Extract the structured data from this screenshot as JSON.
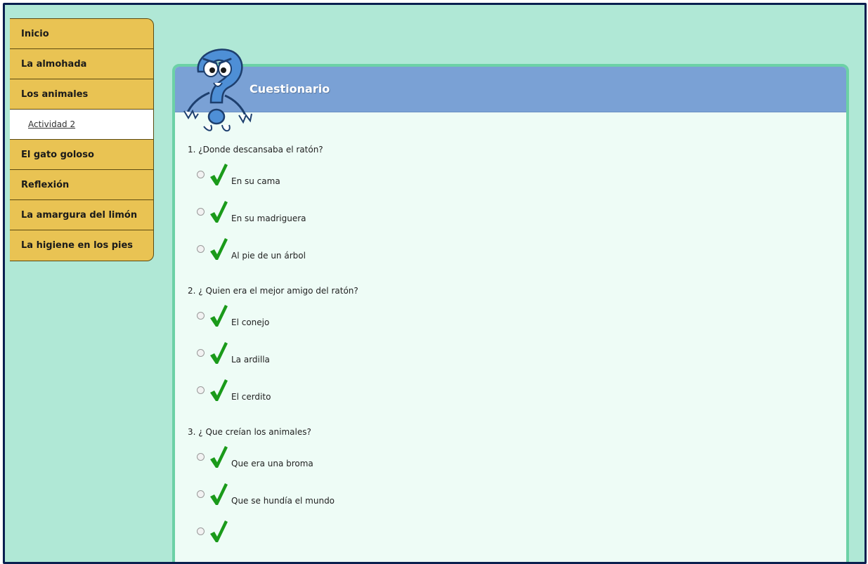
{
  "sidebar": {
    "items": [
      {
        "label": "Inicio"
      },
      {
        "label": "La almohada"
      },
      {
        "label": "Los animales"
      },
      {
        "label": "Actividad 2"
      },
      {
        "label": "El gato goloso"
      },
      {
        "label": "Reflexión"
      },
      {
        "label": "La amargura del limón"
      },
      {
        "label": "La higiene en los pies"
      }
    ]
  },
  "panel": {
    "title": "Cuestionario"
  },
  "questions": [
    {
      "text": "1. ¿Donde descansaba el ratón?",
      "options": [
        "En su cama",
        "En su madriguera",
        "Al pie de un árbol"
      ]
    },
    {
      "text": "2. ¿ Quien era el mejor amigo del ratón?",
      "options": [
        "El conejo",
        "La ardilla",
        "El cerdito"
      ]
    },
    {
      "text": "3. ¿ Que creían los animales?",
      "options": [
        "Que era una broma",
        "Que se hundía el mundo",
        ""
      ]
    }
  ],
  "icons": {
    "mascot": "question-mark-mascot-icon",
    "check": "checkmark-icon"
  },
  "colors": {
    "background": "#b0e8d6",
    "sidebar": "#e9c353",
    "header": "#7aa1d5",
    "panel_border": "#6cd1a6",
    "check": "#1a9a1a"
  }
}
